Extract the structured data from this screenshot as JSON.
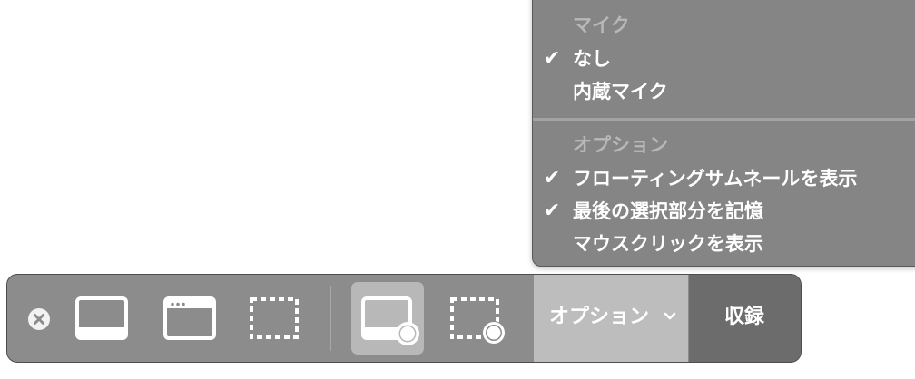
{
  "menu": {
    "mic_header": "マイク",
    "mic_items": [
      {
        "label": "なし",
        "checked": true
      },
      {
        "label": "内蔵マイク",
        "checked": false
      }
    ],
    "options_header": "オプション",
    "option_items": [
      {
        "label": "フローティングサムネールを表示",
        "checked": true
      },
      {
        "label": "最後の選択部分を記憶",
        "checked": true
      },
      {
        "label": "マウスクリックを表示",
        "checked": false
      }
    ],
    "check_glyph": "✔"
  },
  "toolbar": {
    "options_label": "オプション",
    "record_label": "収録",
    "buttons": [
      {
        "icon": "close-icon"
      },
      {
        "icon": "capture-entire-screen-icon"
      },
      {
        "icon": "capture-window-icon"
      },
      {
        "icon": "capture-selection-icon"
      },
      {
        "icon": "record-entire-screen-icon",
        "selected": true
      },
      {
        "icon": "record-selection-icon"
      }
    ]
  },
  "colors": {
    "menu_bg": "#858585",
    "toolbar_bg": "#8c8c8c",
    "selected_bg": "#b8b8b8",
    "options_bg": "#bdbdbd",
    "record_bg": "#6c6c6c"
  }
}
